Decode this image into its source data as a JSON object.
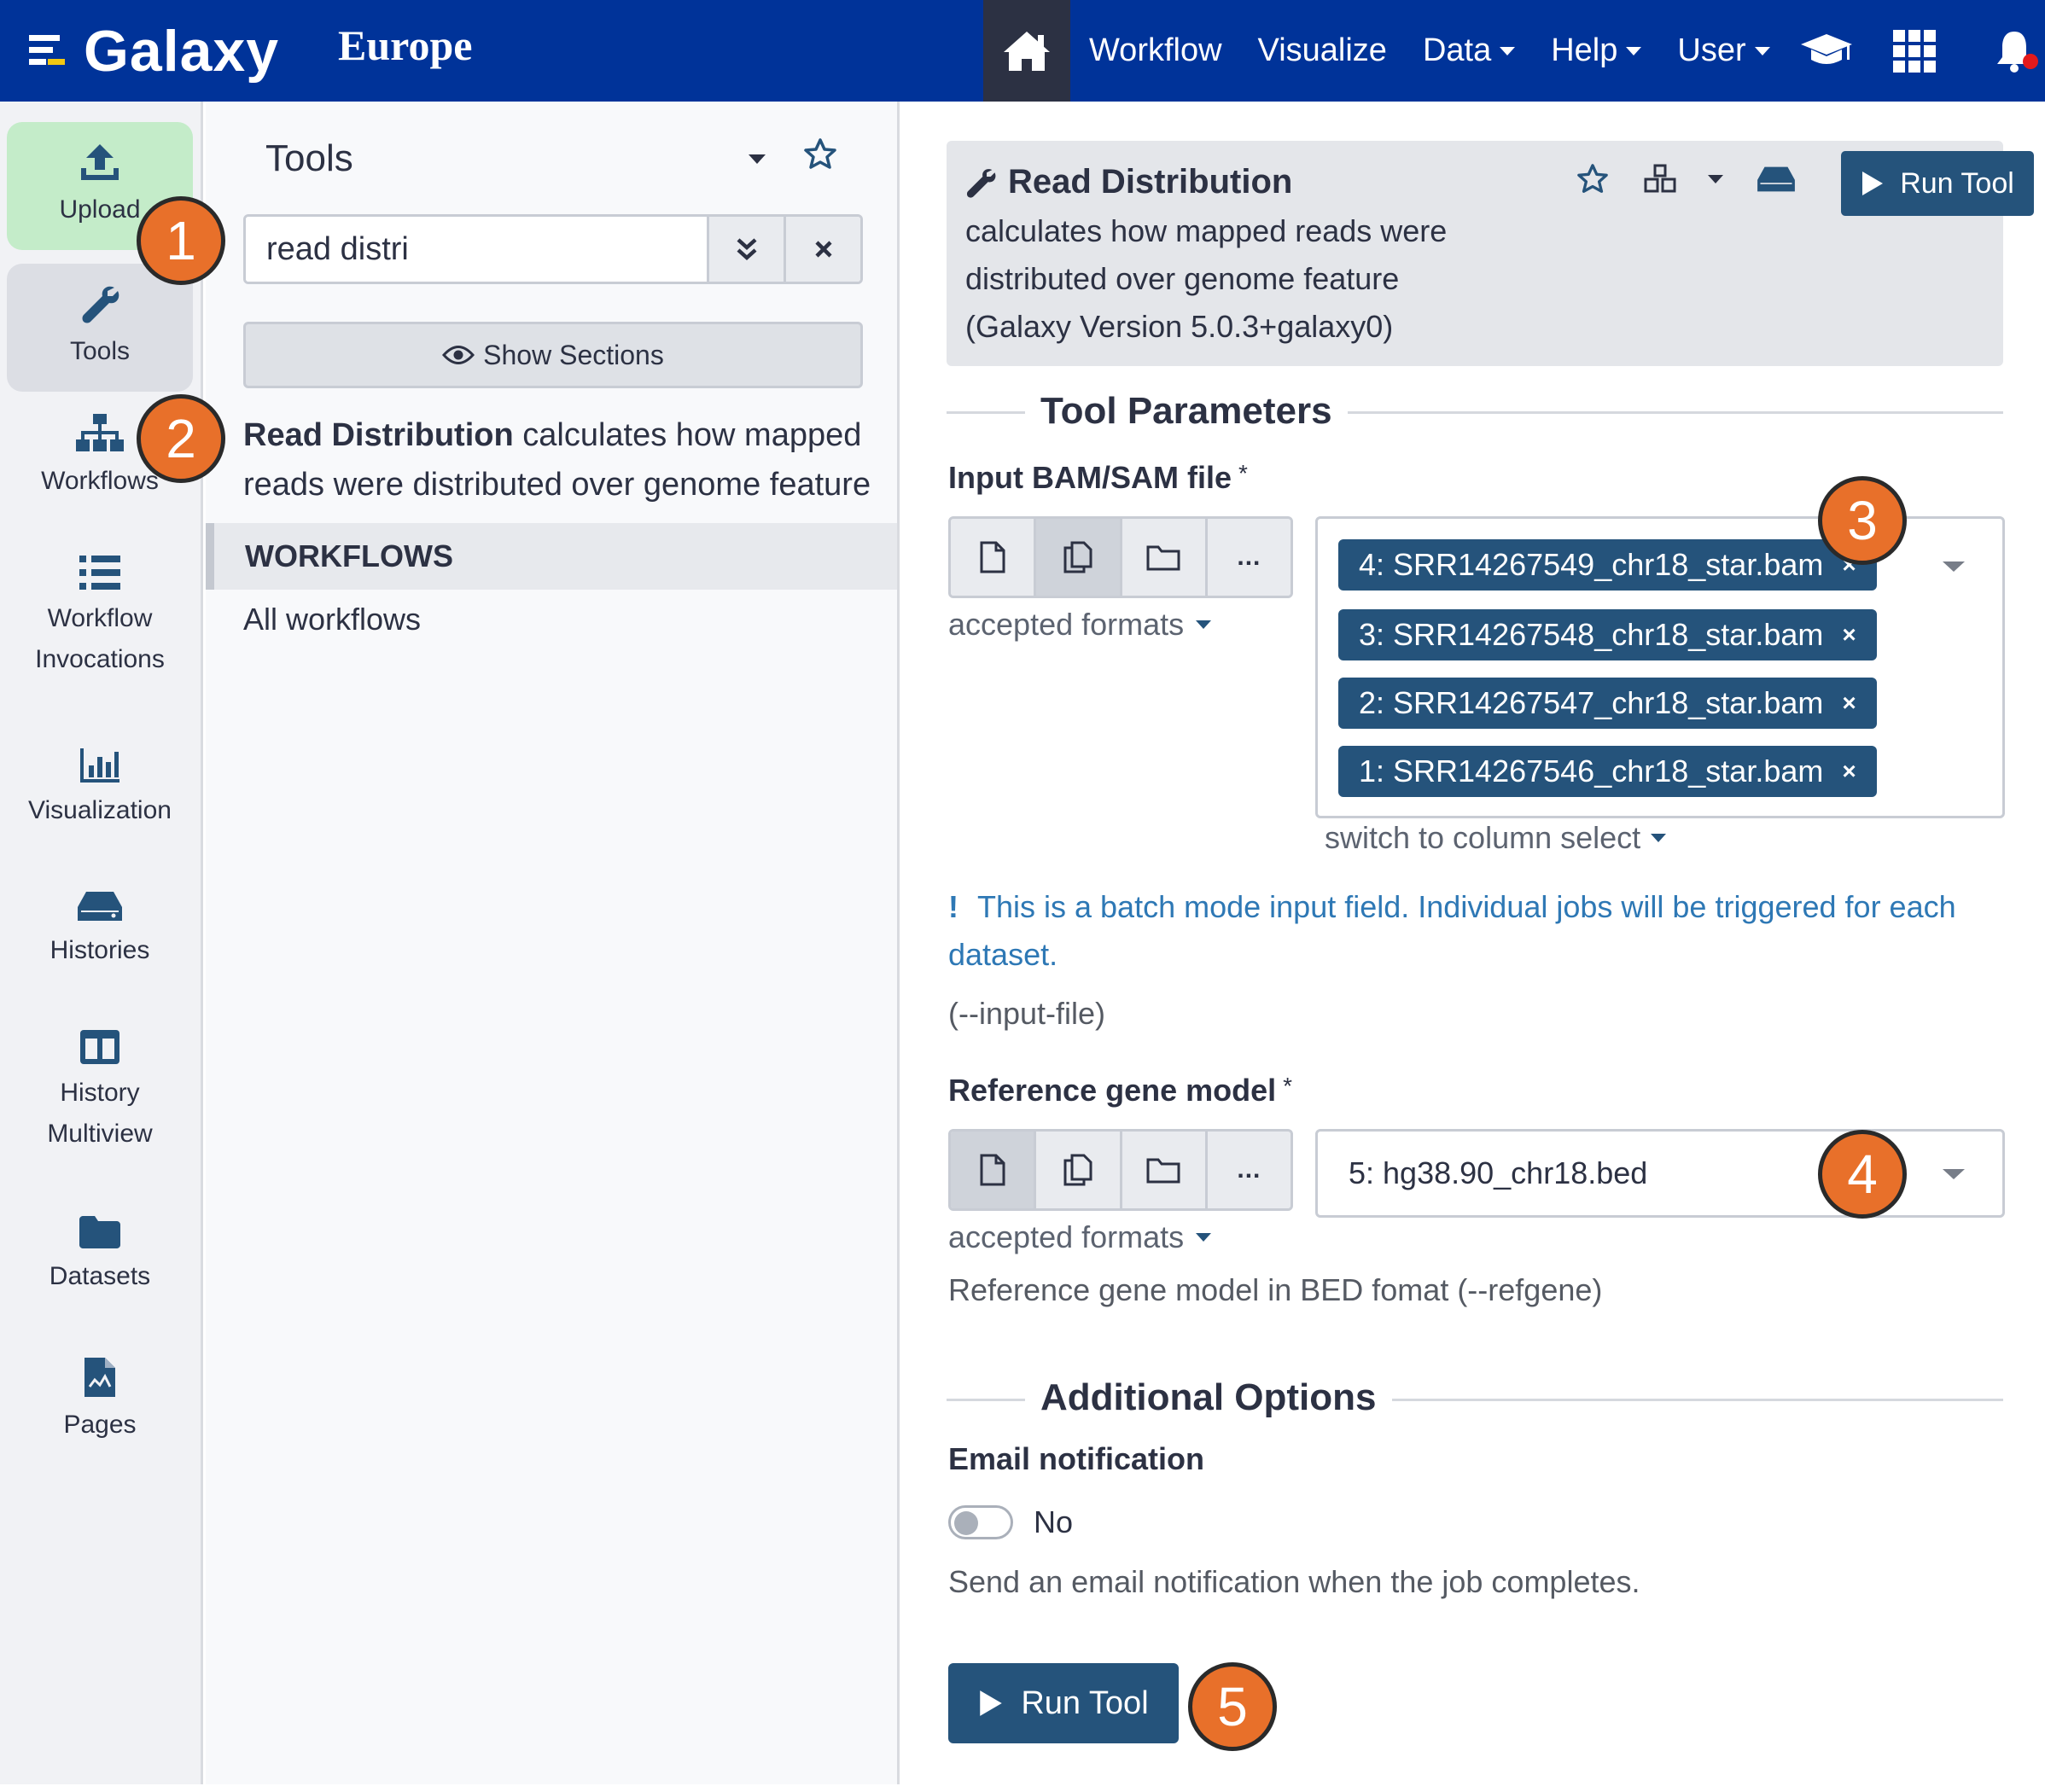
{
  "masthead": {
    "brand": "Galaxy",
    "subtitle": "Europe",
    "nav": {
      "workflow": "Workflow",
      "visualize": "Visualize",
      "data": "Data",
      "help": "Help",
      "user": "User"
    },
    "home_icon": "home-icon",
    "colors": {
      "background": "#003399",
      "home_bg": "#2c3143",
      "notification_dot": "#e31a1c"
    }
  },
  "activity_bar": {
    "items": [
      {
        "label": "Upload",
        "icon": "upload-icon"
      },
      {
        "label": "Tools",
        "icon": "wrench-icon"
      },
      {
        "label": "Workflows",
        "icon": "sitemap-icon"
      },
      {
        "label": "Workflow Invocations",
        "icon": "list-icon"
      },
      {
        "label": "Visualization",
        "icon": "chart-icon"
      },
      {
        "label": "Histories",
        "icon": "hdd-icon"
      },
      {
        "label": "History Multiview",
        "icon": "columns-icon"
      },
      {
        "label": "Datasets",
        "icon": "folder-icon"
      },
      {
        "label": "Pages",
        "icon": "file-icon"
      }
    ]
  },
  "tool_panel": {
    "title": "Tools",
    "search": {
      "value": "read distri"
    },
    "show_sections": "Show Sections",
    "result": {
      "name": "Read Distribution",
      "description": "calculates how mapped reads were distributed over genome feature"
    },
    "workflows_header": "WORKFLOWS",
    "all_workflows": "All workflows"
  },
  "tool_form": {
    "name": "Read Distribution",
    "description": "calculates how mapped reads were distributed over genome feature",
    "version": "(Galaxy Version 5.0.3+galaxy0)",
    "run_label": "Run Tool",
    "parameters_title": "Tool Parameters",
    "input_bam": {
      "label": "Input BAM/SAM file",
      "required_mark": "*",
      "accepted_formats": "accepted formats",
      "selected": [
        "4: SRR14267549_chr18_star.bam",
        "3: SRR14267548_chr18_star.bam",
        "2: SRR14267547_chr18_star.bam",
        "1: SRR14267546_chr18_star.bam"
      ],
      "remove_glyph": "×",
      "switch_label": "switch to column select",
      "batch_note": "This is a batch mode input field. Individual jobs will be triggered for each dataset.",
      "batch_bang": "!",
      "arg": "(--input-file)"
    },
    "ref_gene": {
      "label": "Reference gene model",
      "required_mark": "*",
      "accepted_formats": "accepted formats",
      "selected": "5: hg38.90_chr18.bed",
      "help": "Reference gene model in BED fomat (--refgene)"
    },
    "additional_title": "Additional Options",
    "email": {
      "label": "Email notification",
      "value": "No",
      "help": "Send an email notification when the job completes."
    },
    "colors": {
      "primary": "#25537b",
      "header_bg": "#e4e6ea",
      "info": "#2e78b5"
    }
  },
  "callouts": [
    "1",
    "2",
    "3",
    "4",
    "5"
  ],
  "callout_color": "#e8702a"
}
